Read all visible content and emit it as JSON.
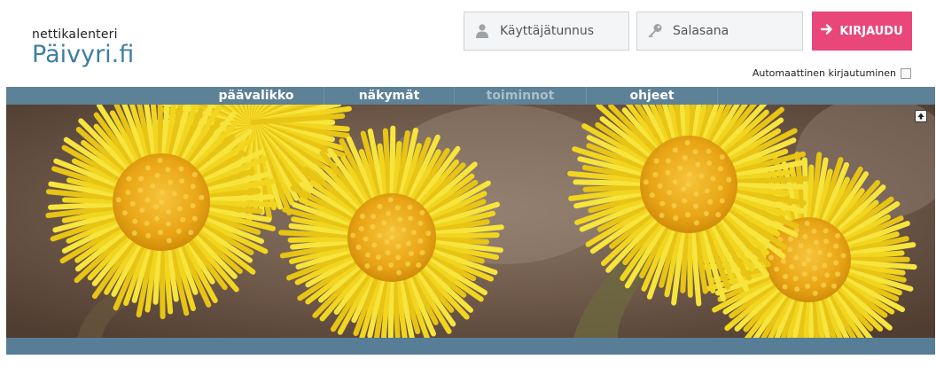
{
  "logo": {
    "small_text": "nettikalenteri",
    "big_text": "Päivyri.fi"
  },
  "login": {
    "username_placeholder": "Käyttäjätunnus",
    "password_placeholder": "Salasana",
    "button_label": "KIRJAUDU",
    "auto_login_label": "Automaattinen kirjautuminen",
    "accent_color": "#e9467a"
  },
  "nav": {
    "items": [
      {
        "label": "päävalikko",
        "enabled": true
      },
      {
        "label": "näkymät",
        "enabled": true
      },
      {
        "label": "toiminnot",
        "enabled": false
      },
      {
        "label": "ohjeet",
        "enabled": true
      }
    ],
    "bar_color": "#5d8197"
  },
  "banner": {
    "subject": "yellow coltsfoot flowers",
    "scroll_top_icon": "arrow-up-icon"
  }
}
